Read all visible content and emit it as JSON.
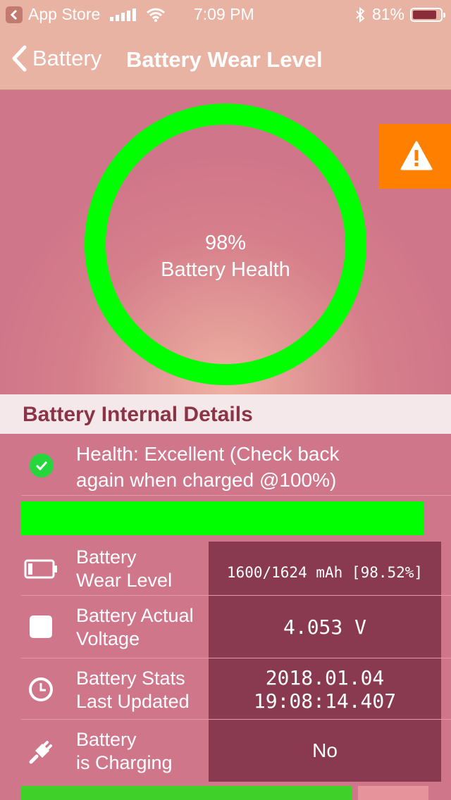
{
  "status_bar": {
    "carrier": "App Store",
    "time": "7:09 PM",
    "battery_percent": "81%"
  },
  "nav": {
    "back_label": "Battery",
    "title": "Battery Wear Level"
  },
  "hero": {
    "health_percent": "98%",
    "health_label": "Battery Health",
    "ring_color": "#00ff00",
    "warning_color": "#ff8000"
  },
  "section": {
    "title": "Battery Internal Details"
  },
  "health": {
    "line1": "Health: Excellent (Check back",
    "line2": "again when charged @100%)"
  },
  "rows": [
    {
      "icon": "battery-icon",
      "label_line1": "Battery",
      "label_line2": "Wear Level",
      "value_line1": "1600/1624 mAh [98.52%]",
      "value_line2": ""
    },
    {
      "icon": "square-icon",
      "label_line1": "Battery Actual",
      "label_line2": "Voltage",
      "value_line1": "4.053 V",
      "value_line2": ""
    },
    {
      "icon": "clock-icon",
      "label_line1": "Battery Stats",
      "label_line2": "Last Updated",
      "value_line1": "2018.01.04",
      "value_line2": "19:08:14.407"
    },
    {
      "icon": "plug-icon",
      "label_line1": "Battery",
      "label_line2": "is Charging",
      "value_line1": "No",
      "value_line2": ""
    }
  ]
}
